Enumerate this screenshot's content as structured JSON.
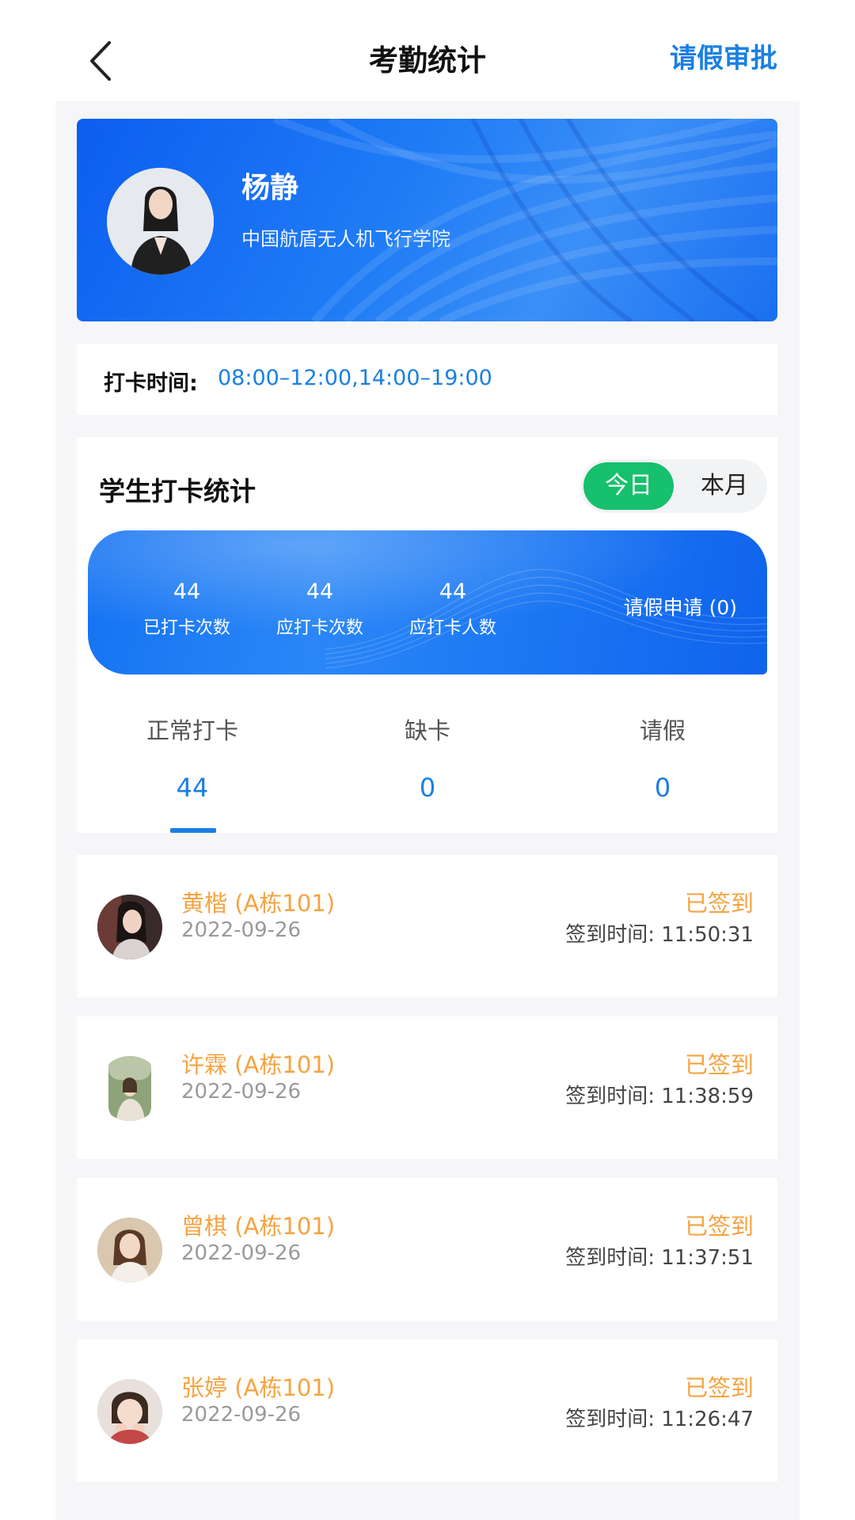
{
  "header": {
    "title": "考勤统计",
    "right_action": "请假审批"
  },
  "profile": {
    "name": "杨静",
    "organization": "中国航盾无人机飞行学院"
  },
  "clock_in": {
    "label": "打卡时间:",
    "value": "08:00–12:00,14:00–19:00"
  },
  "stats": {
    "title": "学生打卡统计",
    "segments": {
      "today": "今日",
      "month": "本月",
      "selected": "今日"
    },
    "summary": [
      {
        "value": "44",
        "label": "已打卡次数"
      },
      {
        "value": "44",
        "label": "应打卡次数"
      },
      {
        "value": "44",
        "label": "应打卡人数"
      }
    ],
    "leave_apply": "请假申请 (0)",
    "tabs": [
      {
        "label": "正常打卡",
        "count": "44"
      },
      {
        "label": "缺卡",
        "count": "0"
      },
      {
        "label": "请假",
        "count": "0"
      }
    ]
  },
  "records": [
    {
      "name": "黄楷 (A栋101)",
      "date": "2022-09-26",
      "status": "已签到",
      "time": "签到时间:  11:50:31"
    },
    {
      "name": "许霖 (A栋101)",
      "date": "2022-09-26",
      "status": "已签到",
      "time": "签到时间:  11:38:59"
    },
    {
      "name": "曾棋 (A栋101)",
      "date": "2022-09-26",
      "status": "已签到",
      "time": "签到时间:  11:37:51"
    },
    {
      "name": "张婷 (A栋101)",
      "date": "2022-09-26",
      "status": "已签到",
      "time": "签到时间:  11:26:47"
    }
  ],
  "colors": {
    "accent_blue": "#1a7fe3",
    "active_green": "#17c06c",
    "status_orange": "#f5a341"
  }
}
